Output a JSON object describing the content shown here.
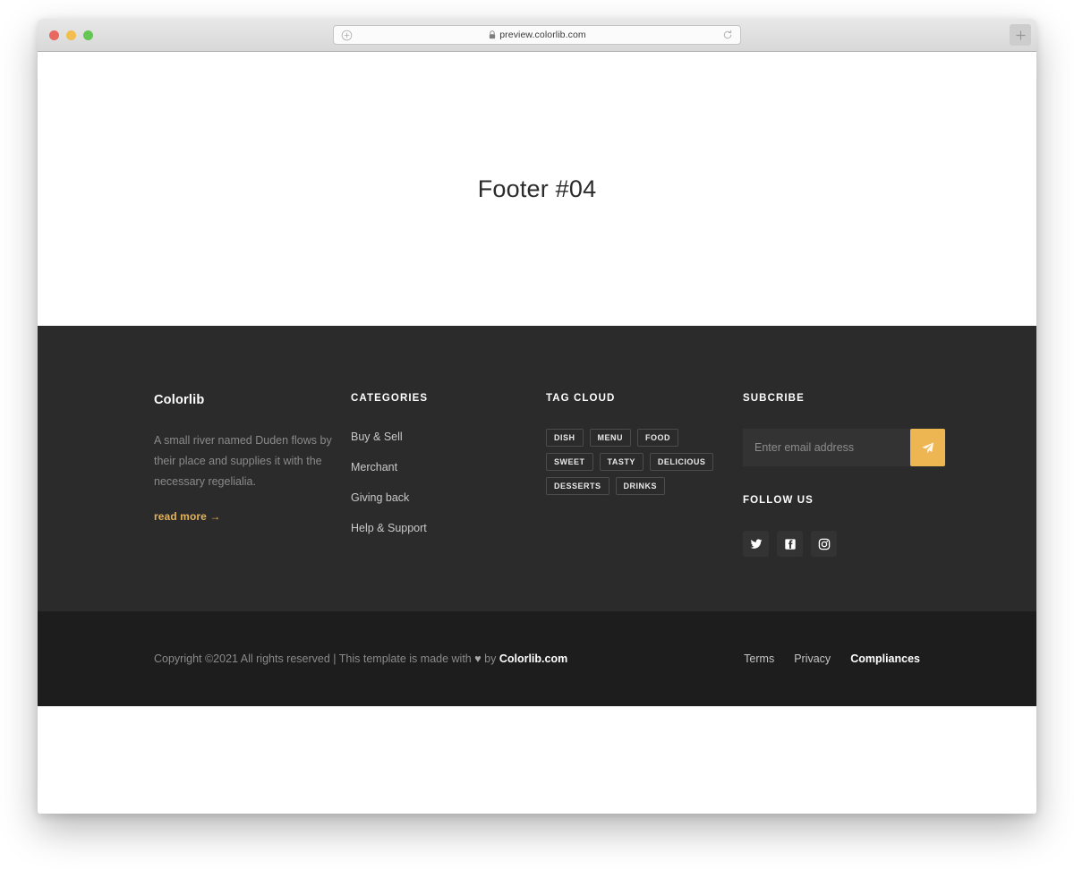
{
  "browser": {
    "url": "preview.colorlib.com",
    "lock_icon": "lock-icon",
    "left_icon": "circle-plus-icon",
    "reload_icon": "reload-icon",
    "newtab_label": "+",
    "traffic_lights": [
      "close-red",
      "minimize-yellow",
      "zoom-green"
    ]
  },
  "hero": {
    "title": "Footer #04"
  },
  "footer": {
    "brand": {
      "title": "Colorlib",
      "description": "A small river named Duden flows by their place and supplies it with the necessary regelialia.",
      "read_more": "read more →"
    },
    "categories": {
      "title": "CATEGORIES",
      "items": [
        {
          "label": "Buy & Sell"
        },
        {
          "label": "Merchant"
        },
        {
          "label": "Giving back"
        },
        {
          "label": "Help & Support"
        }
      ]
    },
    "tag_cloud": {
      "title": "TAG CLOUD",
      "tags": [
        {
          "label": "DISH"
        },
        {
          "label": "MENU"
        },
        {
          "label": "FOOD"
        },
        {
          "label": "SWEET"
        },
        {
          "label": "TASTY"
        },
        {
          "label": "DELICIOUS"
        },
        {
          "label": "DESSERTS"
        },
        {
          "label": "DRINKS"
        }
      ]
    },
    "subscribe": {
      "title": "SUBCRIBE",
      "placeholder": "Enter email address",
      "value": "",
      "submit_icon": "paper-plane-icon",
      "button_color": "#eeb553"
    },
    "follow": {
      "title": "FOLLOW US",
      "socials": [
        {
          "name": "twitter-icon"
        },
        {
          "name": "facebook-icon"
        },
        {
          "name": "instagram-icon"
        }
      ]
    },
    "bottom": {
      "copyright_prefix": "Copyright ©2021 All rights reserved | This template is made with ",
      "heart": "♥",
      "copyright_middle": " by ",
      "brand_link": "Colorlib.com",
      "links": [
        {
          "label": "Terms"
        },
        {
          "label": "Privacy"
        },
        {
          "label": "Compliances"
        }
      ]
    }
  },
  "colors": {
    "footer_bg": "#2b2b2b",
    "footer_bottom_bg": "#1d1d1d",
    "accent": "#eeb553",
    "link_accent": "#e2b25a"
  }
}
